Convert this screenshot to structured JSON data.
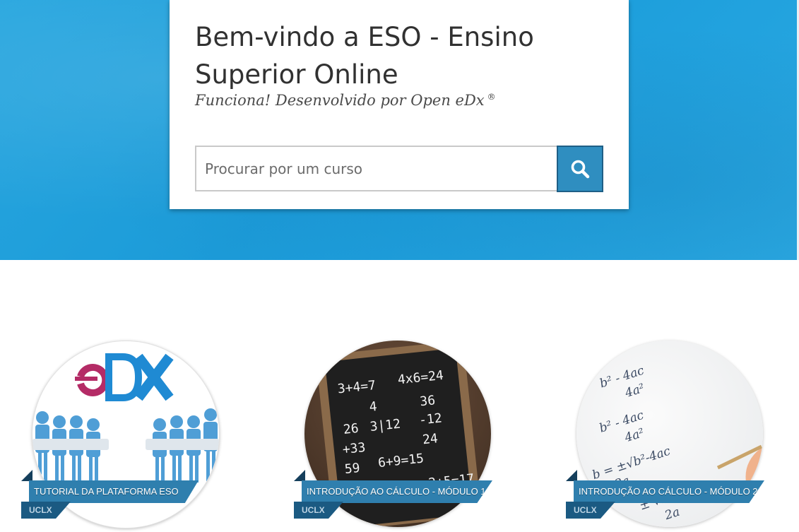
{
  "hero": {
    "title": "Bem-vindo a ESO - Ensino Superior Online",
    "subtitle": "Funciona! Desenvolvido por Open eDx",
    "subtitle_mark": "®"
  },
  "search": {
    "placeholder": "Procurar por um curso",
    "button_icon": "search-icon"
  },
  "courses": [
    {
      "title": "TUTORIAL DA PLATAFORMA ESO",
      "org": "UCLX",
      "image": "edx-logo-people-illustration"
    },
    {
      "title": "INTRODUÇÃO AO CÁLCULO - MÓDULO 1",
      "org": "UCLX",
      "image": "chalkboard-math"
    },
    {
      "title": "INTRODUÇÃO AO CÁLCULO - MÓDULO 2",
      "org": "UCLX",
      "image": "quadratic-formula-paper"
    }
  ],
  "colors": {
    "hero_blue": "#1e9fdc",
    "search_button": "#2f8ec0",
    "ribbon": "#2f7fae",
    "ribbon_dark": "#1b5a82"
  }
}
